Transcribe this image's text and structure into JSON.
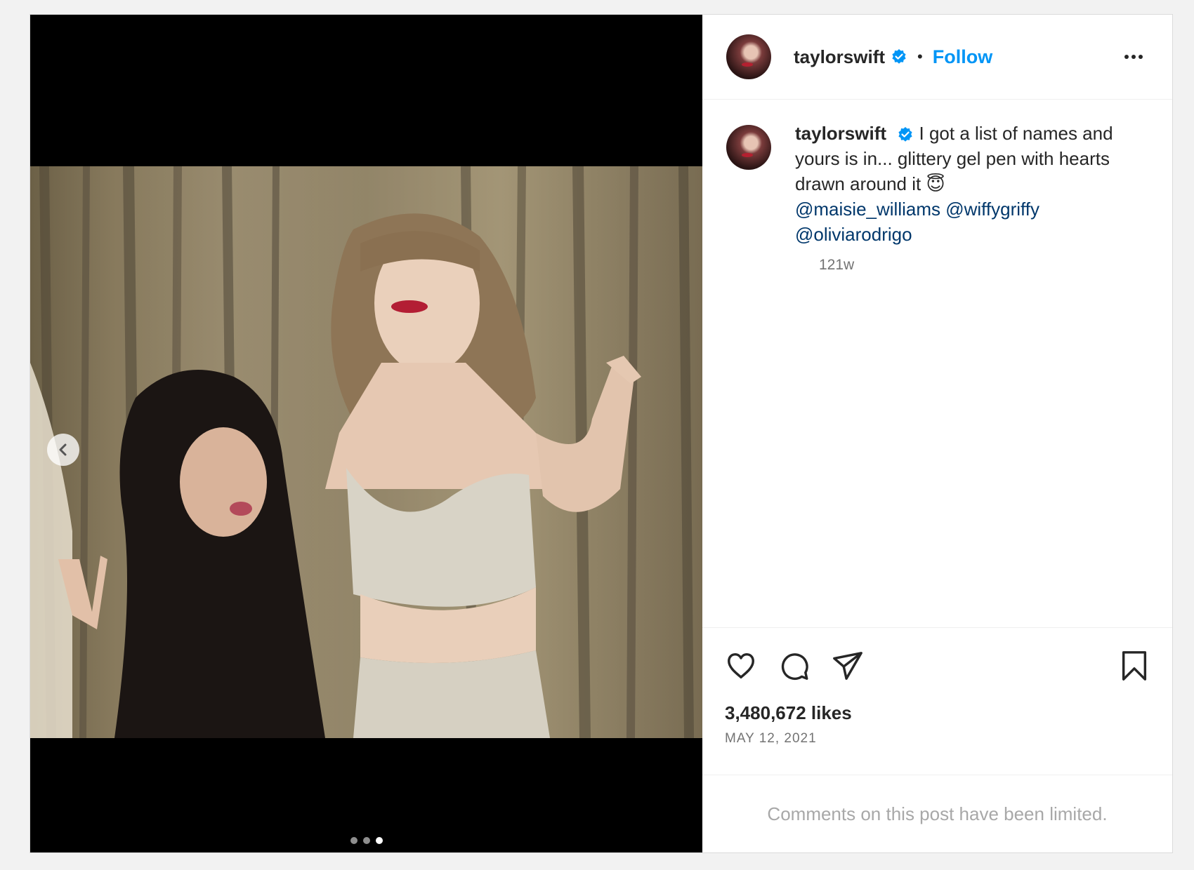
{
  "post": {
    "username": "taylorswift",
    "follow_label": "Follow",
    "separator": "•",
    "caption": {
      "username": "taylorswift",
      "text": "I got a list of names and yours is in... glittery gel pen with hearts drawn around it",
      "emoji": "😇",
      "mentions": [
        "@maisie_williams",
        "@wiffygriffy",
        "@oliviarodrigo"
      ]
    },
    "time_ago": "121w",
    "likes": "3,480,672 likes",
    "date": "MAY 12, 2021",
    "comments_notice": "Comments on this post have been limited.",
    "carousel": {
      "count": 3,
      "active_index": 2
    }
  },
  "colors": {
    "accent": "#0095f6",
    "mention": "#00376b",
    "verified": "#0095f6",
    "muted": "#737373"
  },
  "icons": [
    "chevron-left-icon",
    "verified-badge-icon",
    "more-options-icon",
    "heart-icon",
    "comment-icon",
    "share-icon",
    "bookmark-icon"
  ]
}
